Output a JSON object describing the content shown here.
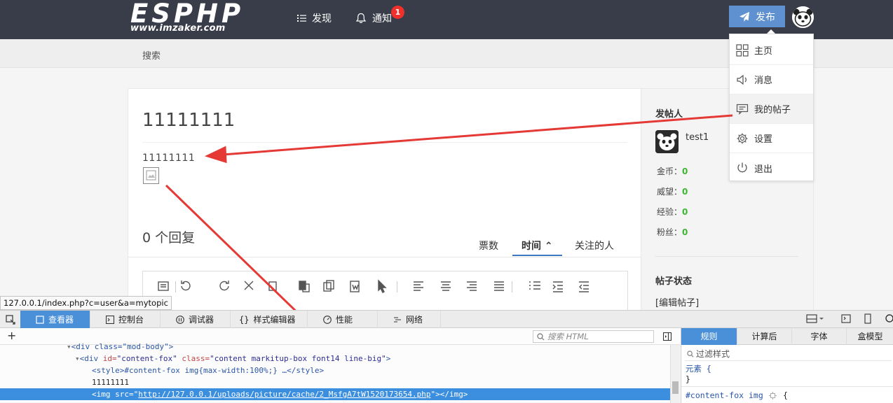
{
  "header": {
    "logo_text": "ESPHP",
    "logo_sub": "www.imzaker.com",
    "nav": [
      {
        "label": "发现"
      },
      {
        "label": "通知",
        "badge": "1"
      }
    ],
    "publish_label": "发布"
  },
  "subnav": {
    "search_label": "搜索"
  },
  "post": {
    "title": "11111111",
    "body": "11111111",
    "reply_count": "0 个回复",
    "tabs": [
      {
        "label": "票数"
      },
      {
        "label": "时间"
      },
      {
        "label": "关注的人"
      }
    ]
  },
  "sidebar": {
    "poster_heading": "发帖人",
    "username": "test1",
    "stats": [
      {
        "label": "金币：",
        "value": "0"
      },
      {
        "label": "威望：",
        "value": "0"
      },
      {
        "label": "经验：",
        "value": "0"
      },
      {
        "label": "粉丝：",
        "value": "0"
      }
    ],
    "status_heading": "帖子状态",
    "edit_link": "[编辑帖子]"
  },
  "user_menu": {
    "items": [
      {
        "label": "主页",
        "icon": "grid-icon"
      },
      {
        "label": "消息",
        "icon": "speaker-icon"
      },
      {
        "label": "我的帖子",
        "icon": "message-icon"
      },
      {
        "label": "设置",
        "icon": "gear-icon"
      },
      {
        "label": "退出",
        "icon": "power-icon"
      }
    ]
  },
  "status_url": "127.0.0.1/index.php?c=user&a=mytopic",
  "devtools": {
    "tabs": [
      {
        "label": "查看器"
      },
      {
        "label": "控制台"
      },
      {
        "label": "调试器"
      },
      {
        "label": "样式编辑器"
      },
      {
        "label": "性能"
      },
      {
        "label": "网络"
      }
    ],
    "search_placeholder": "搜索 HTML",
    "code": {
      "line1": "<div class=\"mod-body\">",
      "line2_tag": "<div ",
      "line2_attr1": "id=",
      "line2_val1": "\"content-fox\"",
      "line2_attr2": " class=",
      "line2_val2": "\"content markitup-box font14 line-big\"",
      "line2_end": ">",
      "line3": "<style>#content-fox img{max-width:100%;} …</style>",
      "line4": "11111111",
      "line5_tag": "<img ",
      "line5_attr": "src=",
      "line5_url": "http://127.0.0.1/uploads/picture/cache/2_MsfgA7tW1520173654.php",
      "line5_end": "\"></img>"
    },
    "right_tabs": [
      {
        "label": "规则"
      },
      {
        "label": "计算后"
      },
      {
        "label": "字体"
      },
      {
        "label": "盒模型"
      }
    ],
    "filter_placeholder": "过滤样式",
    "rules": [
      "元素 {",
      "}",
      "#content-fox img",
      "{"
    ]
  },
  "colors": {
    "topbar": "#393d49",
    "accent": "#5f91d1",
    "devtools_active": "#4a90d9",
    "arrow": "#e53935",
    "stat_value": "#3fb534"
  }
}
